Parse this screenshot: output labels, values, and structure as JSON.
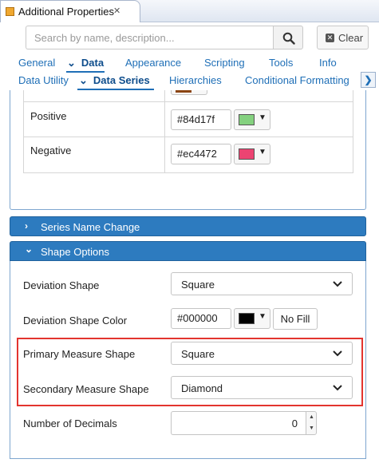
{
  "view": {
    "title": "Additional Properties",
    "close_symbol": "✕"
  },
  "search": {
    "placeholder": "Search by name, description...",
    "clear_label": "Clear"
  },
  "tabs_primary": [
    {
      "label": "General"
    },
    {
      "label": "Data",
      "active": true
    },
    {
      "label": "Appearance"
    },
    {
      "label": "Scripting"
    },
    {
      "label": "Tools"
    },
    {
      "label": "Info"
    }
  ],
  "tabs_secondary": [
    {
      "label": "Data Utility"
    },
    {
      "label": "Data Series",
      "active": true
    },
    {
      "label": "Hierarchies"
    },
    {
      "label": "Conditional Formatting"
    }
  ],
  "tab_scroll_symbol": "❯",
  "color_rows": [
    {
      "label": "Positive",
      "hex": "#84d17f",
      "swatch": "#84d17f"
    },
    {
      "label": "Negative",
      "hex": "#ec4472",
      "swatch": "#ec4472"
    }
  ],
  "sections": {
    "series_name_change": {
      "title": "Series Name Change",
      "expanded": false
    },
    "shape_options": {
      "title": "Shape Options",
      "expanded": true
    }
  },
  "shape_options": {
    "deviation_shape": {
      "label": "Deviation Shape",
      "value": "Square"
    },
    "deviation_shape_color": {
      "label": "Deviation Shape Color",
      "hex": "#000000",
      "swatch": "#000000",
      "no_fill_label": "No Fill"
    },
    "primary_measure_shape": {
      "label": "Primary Measure Shape",
      "value": "Square"
    },
    "secondary_measure_shape": {
      "label": "Secondary Measure Shape",
      "value": "Diamond"
    },
    "number_of_decimals": {
      "label": "Number of Decimals",
      "value": "0"
    }
  },
  "colors": {
    "accent": "#2d7bbf",
    "highlight": "#e3342f",
    "tab_text": "#1f6fb7"
  }
}
